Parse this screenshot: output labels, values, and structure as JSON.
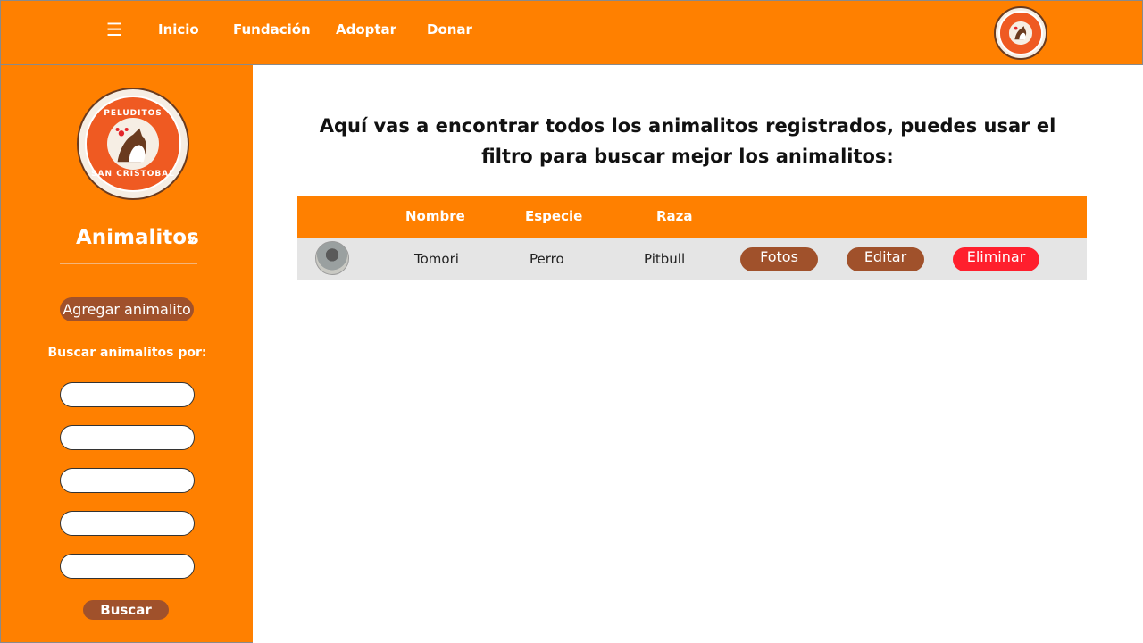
{
  "topbar": {
    "menu_icon": "menu-icon",
    "nav": [
      "Inicio",
      "Fundación",
      "Adoptar",
      "Donar"
    ],
    "logo_icon": "peluditos-logo"
  },
  "sidebar": {
    "logo_text_top": "PELUDITOS",
    "logo_text_bottom": "SAN CRISTOBAL",
    "title": "Animalitos",
    "chevron": "v",
    "add_button": "Agregar animalito",
    "search_label": "Buscar animalitos por:",
    "filters": [
      "",
      "",
      "",
      "",
      ""
    ],
    "search_button": "Buscar"
  },
  "main": {
    "heading": "Aquí vas a encontrar todos los animalitos registrados, puedes usar el filtro para buscar mejor los animalitos:"
  },
  "table": {
    "columns": [
      "Nombre",
      "Especie",
      "Raza"
    ],
    "rows": [
      {
        "nombre": "Tomori",
        "especie": "Perro",
        "raza": "Pitbull",
        "actions": [
          "Fotos",
          "Editar",
          "Eliminar"
        ]
      }
    ]
  },
  "colors": {
    "orange": "#FF8000",
    "brown_button": "#a0512b",
    "delete_button": "#ff1f2d",
    "row_bg": "#e5e5e5"
  }
}
